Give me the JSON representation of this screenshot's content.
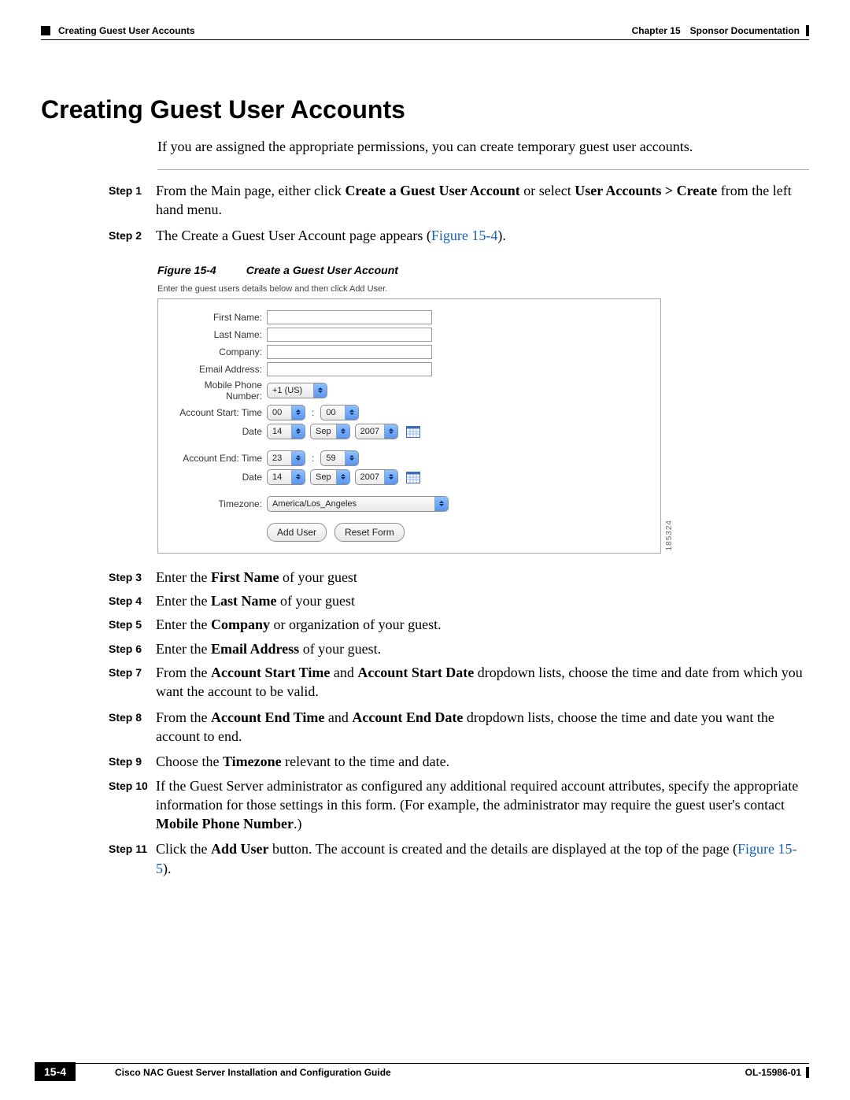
{
  "header": {
    "left_breadcrumb": "Creating Guest User Accounts",
    "chapter": "Chapter 15",
    "section": "Sponsor Documentation"
  },
  "title": "Creating Guest User Accounts",
  "intro": "If you are assigned the appropriate permissions, you can create temporary guest user accounts.",
  "figure": {
    "label": "Figure 15-4",
    "caption": "Create a Guest User Account",
    "instruction": "Enter the guest users details below and then click Add User.",
    "side_id": "185324",
    "fields": {
      "first_name_label": "First Name:",
      "last_name_label": "Last Name:",
      "company_label": "Company:",
      "email_label": "Email Address:",
      "mobile_label": "Mobile Phone Number:",
      "mobile_sel": "+1 (US)",
      "start_time_label": "Account Start: Time",
      "start_hh": "00",
      "start_mm": "00",
      "start_date_label": "Date",
      "start_day": "14",
      "start_mon": "Sep",
      "start_year": "2007",
      "end_time_label": "Account End: Time",
      "end_hh": "23",
      "end_mm": "59",
      "end_date_label": "Date",
      "end_day": "14",
      "end_mon": "Sep",
      "end_year": "2007",
      "tz_label": "Timezone:",
      "tz_value": "America/Los_Angeles",
      "btn_add": "Add User",
      "btn_reset": "Reset Form"
    }
  },
  "steps": {
    "s1_label": "Step 1",
    "s1_a": "From the Main page, either click ",
    "s1_b": "Create a Guest User Account",
    "s1_c": " or select ",
    "s1_d": "User Accounts > Create",
    "s1_e": " from the left hand menu.",
    "s2_label": "Step 2",
    "s2_a": "The Create a Guest User Account page appears (",
    "s2_link": "Figure 15-4",
    "s2_b": ").",
    "s3_label": "Step 3",
    "s3_a": "Enter the ",
    "s3_b": "First Name",
    "s3_c": " of your guest",
    "s4_label": "Step 4",
    "s4_a": "Enter the ",
    "s4_b": "Last Name",
    "s4_c": " of your guest",
    "s5_label": "Step 5",
    "s5_a": "Enter the ",
    "s5_b": "Company",
    "s5_c": " or organization of your guest.",
    "s6_label": "Step 6",
    "s6_a": "Enter the ",
    "s6_b": "Email Address",
    "s6_c": " of your guest.",
    "s7_label": "Step 7",
    "s7_a": "From the ",
    "s7_b": "Account Start Time",
    "s7_c": " and ",
    "s7_d": "Account Start Date",
    "s7_e": " dropdown lists, choose the time and date from which you want the account to be valid.",
    "s8_label": "Step 8",
    "s8_a": "From the ",
    "s8_b": "Account End Time",
    "s8_c": " and ",
    "s8_d": "Account End Date",
    "s8_e": " dropdown lists, choose the time and date you want the account to end.",
    "s9_label": "Step 9",
    "s9_a": "Choose the ",
    "s9_b": "Timezone",
    "s9_c": " relevant to the time and date.",
    "s10_label": "Step 10",
    "s10_a": "If the Guest Server administrator as configured any additional required account attributes, specify the appropriate information for those settings in this form. (For example, the administrator may require the guest user's contact ",
    "s10_b": "Mobile Phone Number",
    "s10_c": ".)",
    "s11_label": "Step 11",
    "s11_a": "Click the ",
    "s11_b": "Add User",
    "s11_c": " button. The account is created and the details are displayed at the top of the page (",
    "s11_link": "Figure 15-5",
    "s11_d": ")."
  },
  "footer": {
    "book_title": "Cisco NAC Guest Server Installation and Configuration Guide",
    "page_num": "15-4",
    "doc_id": "OL-15986-01"
  }
}
